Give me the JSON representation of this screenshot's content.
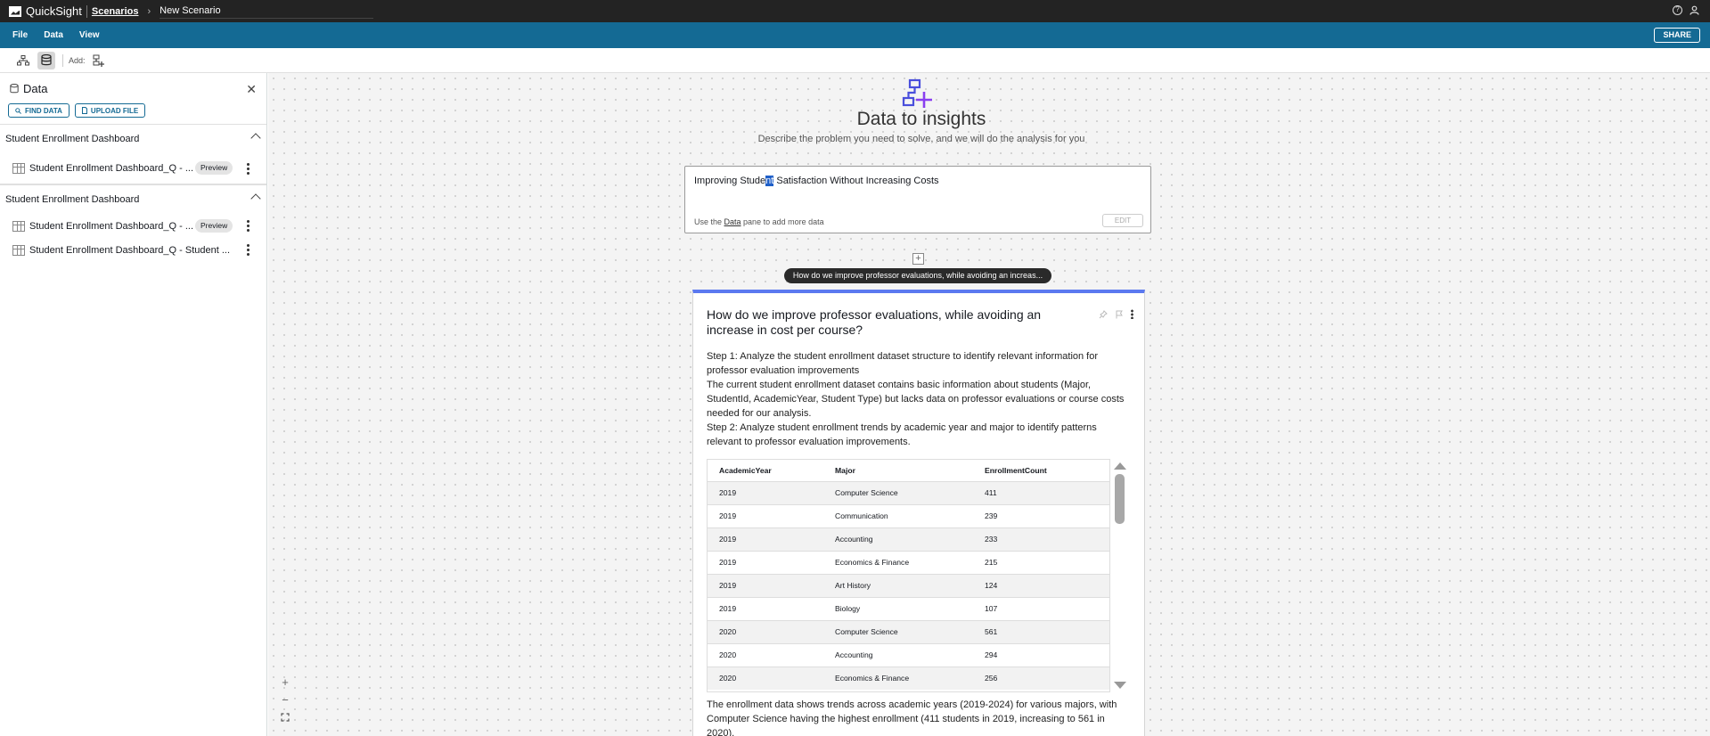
{
  "topbar": {
    "app_name": "QuickSight",
    "breadcrumb_link": "Scenarios",
    "breadcrumb_current": "New Scenario"
  },
  "menu": {
    "file": "File",
    "data": "Data",
    "view": "View",
    "share": "SHARE"
  },
  "toolbar": {
    "add_label": "Add:"
  },
  "data_panel": {
    "title": "Data",
    "find_data": "FIND DATA",
    "upload_file": "UPLOAD FILE",
    "groups": [
      {
        "name": "Student Enrollment Dashboard",
        "items": [
          {
            "name": "Student Enrollment Dashboard_Q - ...",
            "badge": "Preview"
          }
        ]
      },
      {
        "name": "Student Enrollment Dashboard",
        "items": [
          {
            "name": "Student Enrollment Dashboard_Q - ...",
            "badge": "Preview"
          },
          {
            "name": "Student Enrollment Dashboard_Q - Student ...",
            "badge": ""
          }
        ]
      }
    ]
  },
  "hero": {
    "title": "Data to insights",
    "subtitle": "Describe the problem you need to solve, and we will do the analysis for you"
  },
  "prompt": {
    "text_before": "Improving Stude",
    "text_selected": "nt",
    "text_after": " Satisfaction Without Increasing Costs",
    "hint_prefix": "Use the ",
    "hint_link": "Data",
    "hint_suffix": " pane to add more data",
    "edit": "EDIT"
  },
  "question_pill": "How do we improve professor evaluations, while avoiding an increas...",
  "card": {
    "title": "How do we improve professor evaluations, while avoiding an increase in cost per course?",
    "step1_title": "Step 1: Analyze the student enrollment dataset structure to identify relevant information for professor evaluation improvements",
    "step1_body": "The current student enrollment dataset contains basic information about students (Major, StudentId, AcademicYear, Student Type) but lacks data on professor evaluations or course costs needed for our analysis.",
    "step2_title": "Step 2: Analyze student enrollment trends by academic year and major to identify patterns relevant to professor evaluation improvements.",
    "table": {
      "columns": [
        "AcademicYear",
        "Major",
        "EnrollmentCount"
      ],
      "rows": [
        [
          "2019",
          "Computer Science",
          "411"
        ],
        [
          "2019",
          "Communication",
          "239"
        ],
        [
          "2019",
          "Accounting",
          "233"
        ],
        [
          "2019",
          "Economics & Finance",
          "215"
        ],
        [
          "2019",
          "Art History",
          "124"
        ],
        [
          "2019",
          "Biology",
          "107"
        ],
        [
          "2020",
          "Computer Science",
          "561"
        ],
        [
          "2020",
          "Accounting",
          "294"
        ],
        [
          "2020",
          "Economics & Finance",
          "256"
        ]
      ]
    },
    "summary": "The enrollment data shows trends across academic years (2019-2024) for various majors, with Computer Science having the highest enrollment (411 students in 2019, increasing to 561 in 2020)."
  },
  "colors": {
    "menubar": "#146a94",
    "topbar": "#232323",
    "card_accent": "#5b79f0",
    "selection": "#1f5fc8"
  }
}
